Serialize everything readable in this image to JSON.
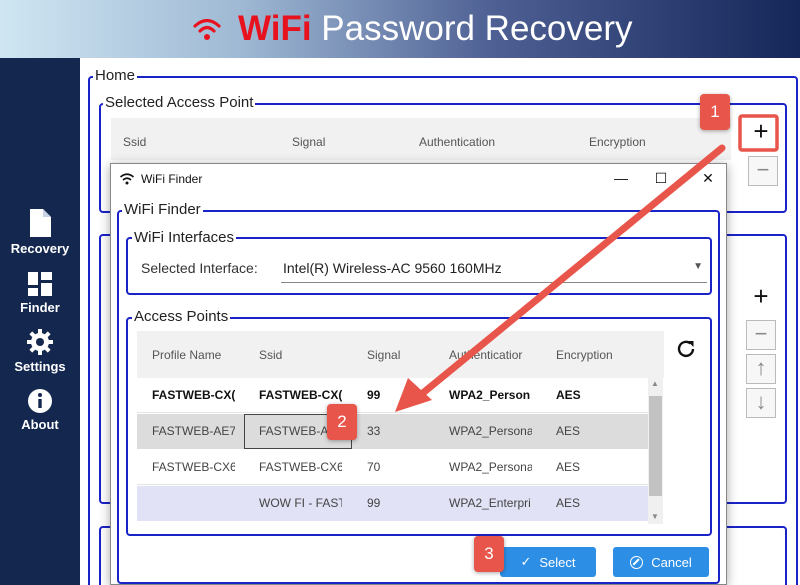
{
  "banner": {
    "title_accent": "WiFi",
    "title_rest": " Password Recovery",
    "icon": "wifi-icon"
  },
  "sidebar": {
    "items": [
      {
        "label": "Recovery",
        "icon": "document-icon"
      },
      {
        "label": "Finder",
        "icon": "grid-icon"
      },
      {
        "label": "Settings",
        "icon": "gear-icon"
      },
      {
        "label": "About",
        "icon": "info-icon"
      }
    ]
  },
  "main": {
    "home_label": "Home",
    "selected_ap_label": "Selected Access Point",
    "columns": [
      "Ssid",
      "Signal",
      "Authentication",
      "Encryption"
    ],
    "side_buttons": [
      "+",
      "−",
      "↑",
      "↓"
    ]
  },
  "dialog": {
    "title": "WiFi Finder",
    "group_label": "WiFi Finder",
    "interfaces_label": "WiFi Interfaces",
    "selected_interface_label": "Selected Interface:",
    "selected_interface_value": "Intel(R) Wireless-AC 9560 160MHz",
    "access_points_label": "Access Points",
    "table": {
      "headers": [
        "Profile Name",
        "Ssid",
        "Signal",
        "Authenticatior",
        "Encryption"
      ],
      "rows": [
        [
          "FASTWEB-CX(",
          "FASTWEB-CX(",
          "99",
          "WPA2_Person",
          "AES"
        ],
        [
          "FASTWEB-AE7/",
          "FASTWEB-A",
          "33",
          "WPA2_Persona",
          "AES"
        ],
        [
          "FASTWEB-CX6",
          "FASTWEB-CX6",
          "70",
          "WPA2_Persona",
          "AES"
        ],
        [
          "",
          "WOW FI - FAST",
          "99",
          "WPA2_Enterpri",
          "AES"
        ]
      ]
    },
    "select_label": "Select",
    "cancel_label": "Cancel"
  },
  "annotations": [
    "1",
    "2",
    "3"
  ],
  "colors": {
    "group_border": "#1a23c8",
    "sidebar_bg": "#14284f",
    "button_blue": "#2d8ee6",
    "annotation_red": "#e8554a",
    "title_red": "#e8121e"
  }
}
